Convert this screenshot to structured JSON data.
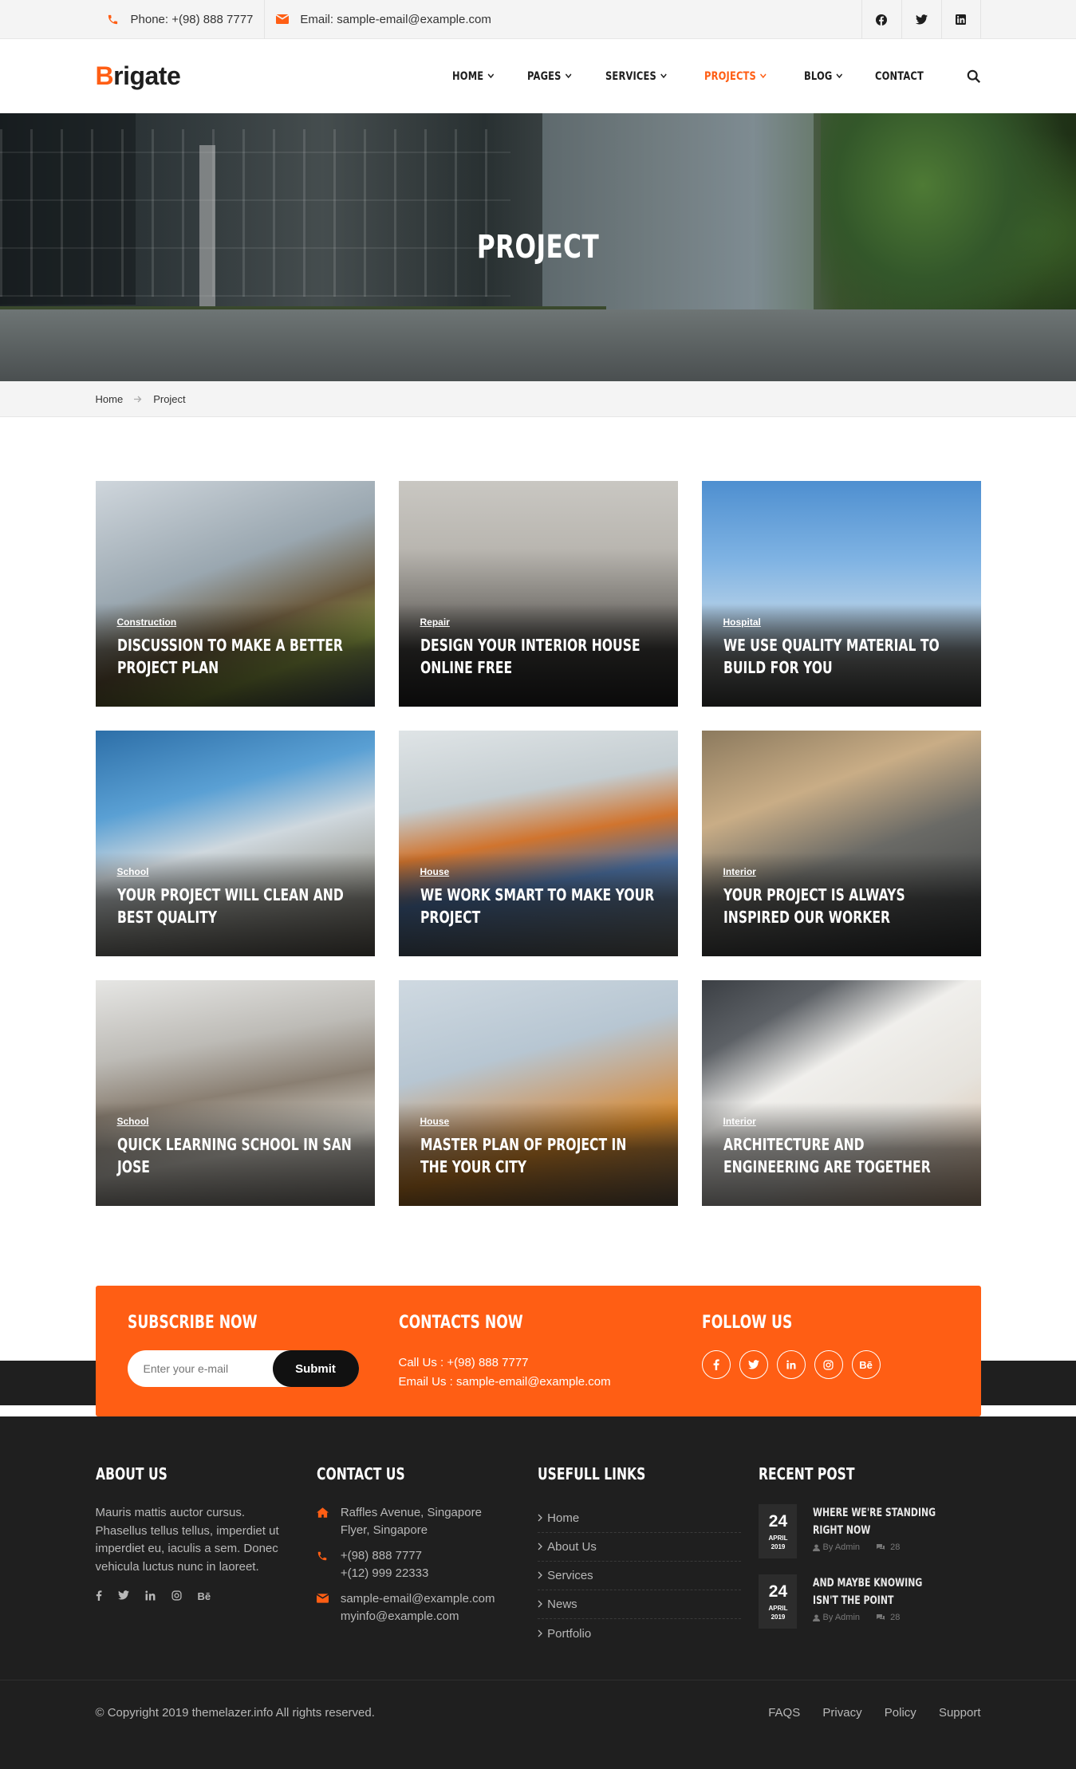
{
  "topbar": {
    "phone": "Phone: +(98) 888 7777",
    "email": "Email: sample-email@example.com"
  },
  "header": {
    "logo_accent": "B",
    "logo_rest": "rigate",
    "nav": [
      "HOME",
      "PAGES",
      "SERVICES",
      "PROJECTS",
      "BLOG",
      "CONTACT"
    ]
  },
  "hero": {
    "title": "PROJECT"
  },
  "breadcrumb": {
    "home": "Home",
    "current": "Project"
  },
  "projects": [
    {
      "category": "Construction",
      "title": "DISCUSSION TO MAKE A BETTER PROJECT PLAN"
    },
    {
      "category": "Repair",
      "title": "DESIGN YOUR INTERIOR HOUSE ONLINE FREE"
    },
    {
      "category": "Hospital",
      "title": "WE USE QUALITY MATERIAL TO BUILD FOR YOU"
    },
    {
      "category": "School",
      "title": "YOUR PROJECT WILL CLEAN AND BEST QUALITY"
    },
    {
      "category": "House",
      "title": "WE WORK SMART TO MAKE YOUR PROJECT"
    },
    {
      "category": "Interior",
      "title": "YOUR PROJECT IS ALWAYS INSPIRED OUR WORKER"
    },
    {
      "category": "School",
      "title": "QUICK LEARNING SCHOOL IN SAN JOSE"
    },
    {
      "category": "House",
      "title": "MASTER PLAN OF PROJECT IN THE YOUR CITY"
    },
    {
      "category": "Interior",
      "title": "ARCHITECTURE AND ENGINEERING ARE TOGETHER"
    }
  ],
  "subscribe": {
    "title": "SUBSCRIBE NOW",
    "placeholder": "Enter your e-mail",
    "button": "Submit",
    "contacts_title": "CONTACTS NOW",
    "call": "Call Us : +(98) 888 7777",
    "email": "Email Us : sample-email@example.com",
    "follow_title": "FOLLOW US",
    "behance": "Bē"
  },
  "footer": {
    "about_title": "ABOUT US",
    "about_text": "Mauris mattis auctor cursus. Phasellus tellus tellus, imperdiet ut imperdiet eu, iaculis a sem. Donec vehicula luctus nunc in laoreet.",
    "behance": "Bē",
    "contact_title": "CONTACT US",
    "address": [
      "Raffles Avenue, Singapore",
      "Flyer, Singapore"
    ],
    "phones": [
      "+(98) 888 7777",
      "+(12) 999 22333"
    ],
    "emails": [
      "sample-email@example.com",
      "myinfo@example.com"
    ],
    "links_title": "USEFULL LINKS",
    "links": [
      "Home",
      "About Us",
      "Services",
      "News",
      "Portfolio"
    ],
    "recent_title": "RECENT POST",
    "posts": [
      {
        "day": "24",
        "month": "APRIL",
        "year": "2019",
        "title": "WHERE WE'RE STANDING RIGHT NOW",
        "author": "By Admin",
        "comments": "28"
      },
      {
        "day": "24",
        "month": "APRIL",
        "year": "2019",
        "title": "AND MAYBE KNOWING ISN'T THE POINT",
        "author": "By Admin",
        "comments": "28"
      }
    ],
    "copyright": "© Copyright 2019 themelazer.info All rights reserved.",
    "bottom_links": [
      "FAQS",
      "Privacy",
      "Policy",
      "Support"
    ]
  },
  "colors": {
    "accent": "#ff5e14",
    "dark": "#1f1f1f"
  }
}
